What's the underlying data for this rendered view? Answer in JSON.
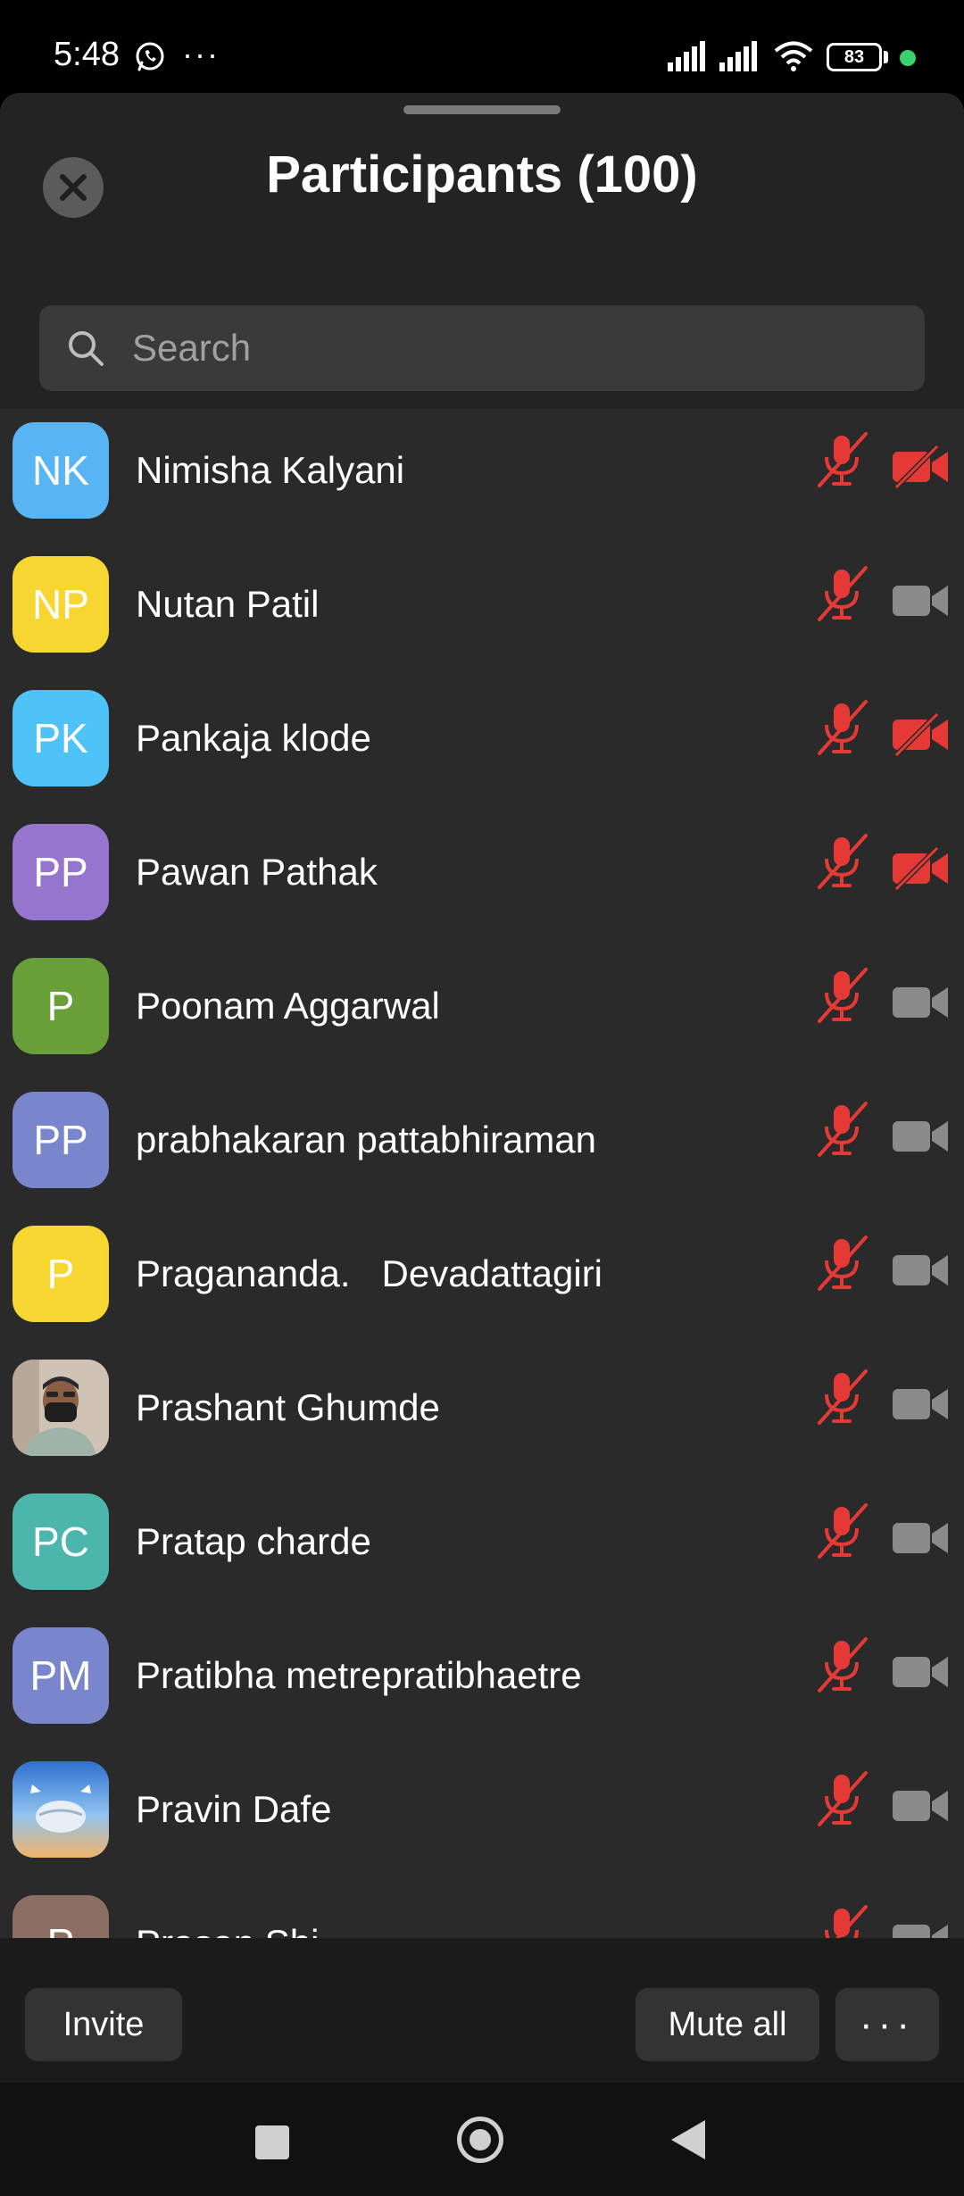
{
  "status_bar": {
    "time": "5:48",
    "overflow_dots": "···",
    "battery": "83"
  },
  "header": {
    "title": "Participants (100)"
  },
  "search": {
    "placeholder": "Search",
    "value": ""
  },
  "participants": [
    {
      "initials": "NK",
      "name": "Nimisha Kalyani",
      "avatar_color": "#58b4f2",
      "mic": "muted",
      "video": "off"
    },
    {
      "initials": "NP",
      "name": "Nutan Patil",
      "avatar_color": "#f7d631",
      "mic": "muted",
      "video": "on"
    },
    {
      "initials": "PK",
      "name": "Pankaja klode",
      "avatar_color": "#4fc3f7",
      "mic": "muted",
      "video": "off"
    },
    {
      "initials": "PP",
      "name": "Pawan Pathak",
      "avatar_color": "#9575cd",
      "mic": "muted",
      "video": "off"
    },
    {
      "initials": "P",
      "name": "Poonam Aggarwal",
      "avatar_color": "#689f38",
      "mic": "muted",
      "video": "on"
    },
    {
      "initials": "PP",
      "name": "prabhakaran pattabhiraman",
      "avatar_color": "#7986cb",
      "mic": "muted",
      "video": "on"
    },
    {
      "initials": "P",
      "name": "Pragananda.   Devadattagiri",
      "avatar_color": "#f7d631",
      "mic": "muted",
      "video": "on"
    },
    {
      "initials": "",
      "name": "Prashant Ghumde",
      "avatar_color": "#c9b8a6",
      "avatar_type": "photo-person",
      "mic": "muted",
      "video": "on"
    },
    {
      "initials": "PC",
      "name": "Pratap charde",
      "avatar_color": "#4db6ac",
      "mic": "muted",
      "video": "on"
    },
    {
      "initials": "PM",
      "name": "Pratibha metrepratibhaetre",
      "avatar_color": "#7986cb",
      "mic": "muted",
      "video": "on"
    },
    {
      "initials": "",
      "name": "Pravin Dafe",
      "avatar_color": "#3f7fcf",
      "avatar_type": "photo-landscape",
      "mic": "muted",
      "video": "on"
    },
    {
      "initials": "P",
      "name": "Prasan Shi",
      "avatar_color": "#8d6e63",
      "mic": "muted",
      "video": "on"
    }
  ],
  "bottom_bar": {
    "invite_label": "Invite",
    "mute_all_label": "Mute all",
    "more_label": "···"
  },
  "colors": {
    "muted_red": "#e53935",
    "icon_gray": "#8a8a8a",
    "sheet_bg": "#2a2a2a",
    "header_bg": "#232323"
  }
}
